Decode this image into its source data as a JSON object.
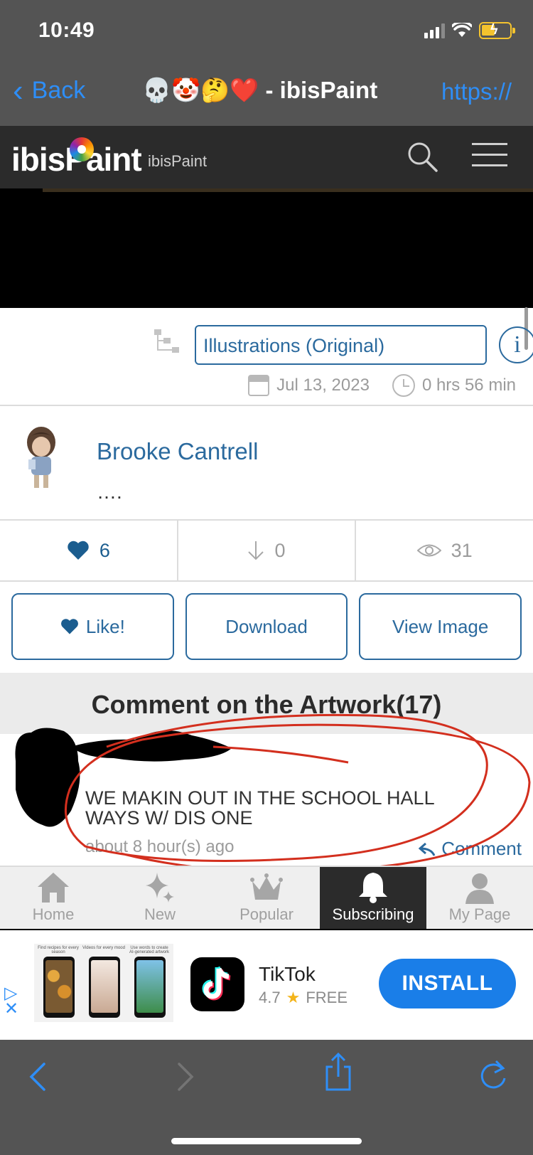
{
  "status": {
    "time": "10:49"
  },
  "browser": {
    "back_label": "Back",
    "title": "💀🤡🤔❤️ - ibisPaint",
    "url_label": "https://"
  },
  "site": {
    "logo_text": "ibisPaint",
    "logo_sub": "ibisPaint"
  },
  "artwork": {
    "category": "Illustrations (Original)",
    "info_symbol": "i",
    "date": "Jul 13, 2023",
    "duration": "0 hrs 56 min"
  },
  "author": {
    "name": "Brooke Cantrell",
    "caption": "…."
  },
  "stats": {
    "likes": "6",
    "downloads": "0",
    "views": "31"
  },
  "actions": {
    "like": "Like!",
    "download": "Download",
    "view_image": "View Image"
  },
  "comments": {
    "header": "Comment on the Artwork(17)",
    "items": [
      {
        "text": "WE MAKIN OUT IN THE SCHOOL HALL WAYS W/ DIS ONE",
        "time": "about 8 hour(s) ago",
        "reply_label": "Comment"
      }
    ]
  },
  "tabs": [
    {
      "label": "Home",
      "icon": "home-icon",
      "active": false
    },
    {
      "label": "New",
      "icon": "sparkle-icon",
      "active": false
    },
    {
      "label": "Popular",
      "icon": "crown-icon",
      "active": false
    },
    {
      "label": "Subscribing",
      "icon": "bell-icon",
      "active": true
    },
    {
      "label": "My Page",
      "icon": "person-icon",
      "active": false
    }
  ],
  "ad": {
    "app_name": "TikTok",
    "rating": "4.7",
    "price": "FREE",
    "install_label": "INSTALL",
    "screenshot_captions": [
      "Find recipes for every season",
      "Videos for every mood",
      "Use words to create AI-generated artwork"
    ]
  },
  "colors": {
    "link_blue": "#2b6a9e",
    "ios_blue": "#2e8ef7",
    "install_blue": "#1a7ee8",
    "chrome_gray": "#545454",
    "header_dark": "#2b2b2b",
    "scribble_red": "#d32f1e"
  }
}
